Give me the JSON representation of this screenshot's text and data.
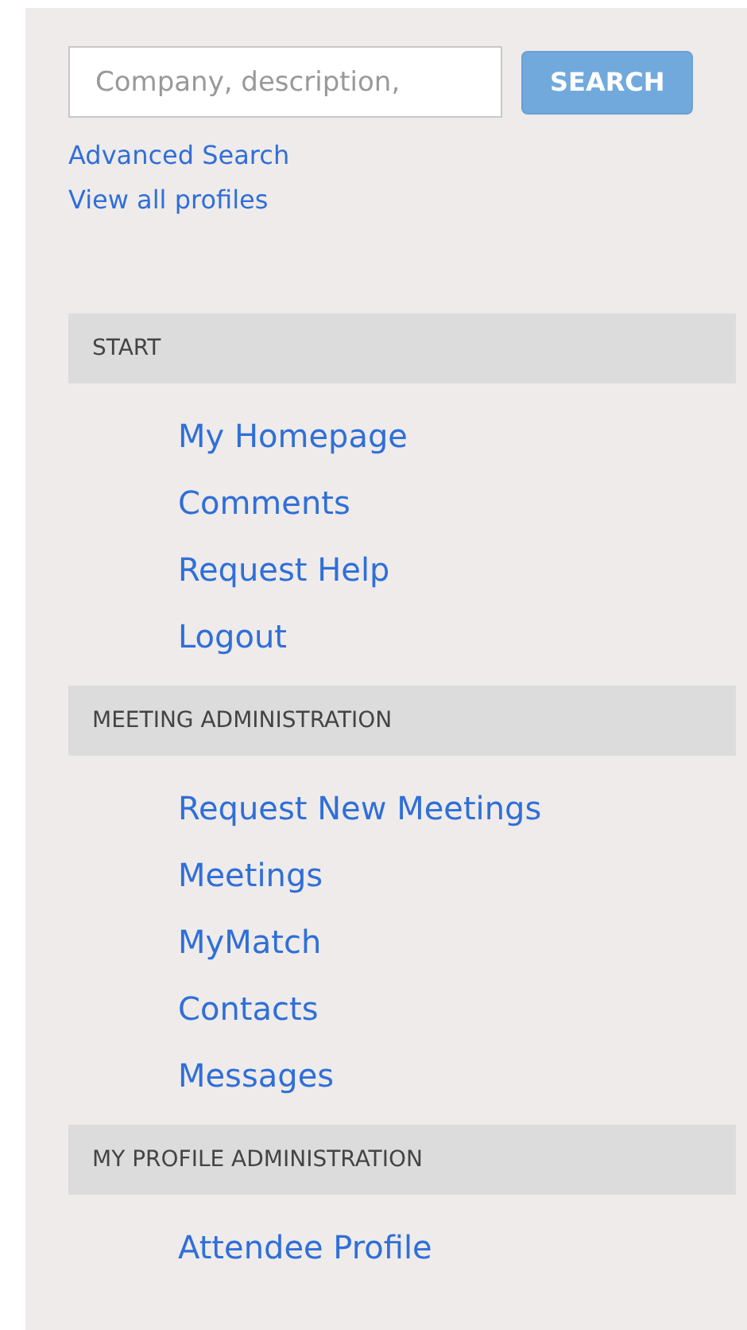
{
  "search": {
    "placeholder": "Company, description,",
    "button": "SEARCH"
  },
  "links": [
    "Advanced Search",
    "View all profiles"
  ],
  "sections": [
    {
      "title": "START",
      "items": [
        "My Homepage",
        "Comments",
        "Request Help",
        "Logout"
      ]
    },
    {
      "title": "MEETING ADMINISTRATION",
      "items": [
        "Request New Meetings",
        "Meetings",
        "MyMatch",
        "Contacts",
        "Messages"
      ]
    },
    {
      "title": "MY PROFILE ADMINISTRATION",
      "items": [
        "Attendee Profile"
      ]
    }
  ]
}
